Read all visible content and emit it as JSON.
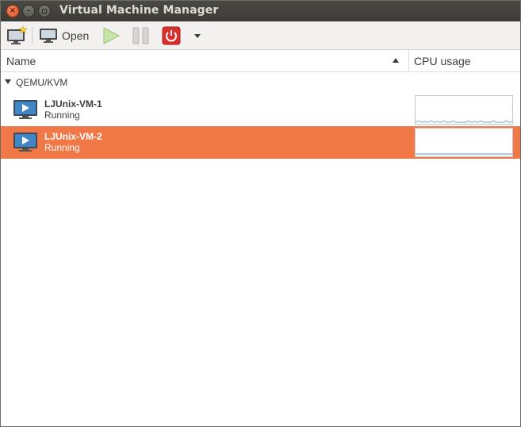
{
  "window": {
    "title": "Virtual Machine Manager"
  },
  "toolbar": {
    "new_vm_icon": "new-vm-icon",
    "open_label": "Open",
    "run_icon": "play-icon",
    "pause_icon": "pause-icon",
    "shutdown_icon": "power-icon",
    "menu_icon": "dropdown-arrow-icon"
  },
  "columns": {
    "name": "Name",
    "cpu": "CPU usage"
  },
  "connection": {
    "label": "QEMU/KVM"
  },
  "vms": [
    {
      "name": "LJUnix-VM-1",
      "status": "Running",
      "selected": false
    },
    {
      "name": "LJUnix-VM-2",
      "status": "Running",
      "selected": true
    }
  ],
  "colors": {
    "selection": "#f07746",
    "cpu_line": "#9fc4dd",
    "titlebar": "#3c3b37"
  }
}
